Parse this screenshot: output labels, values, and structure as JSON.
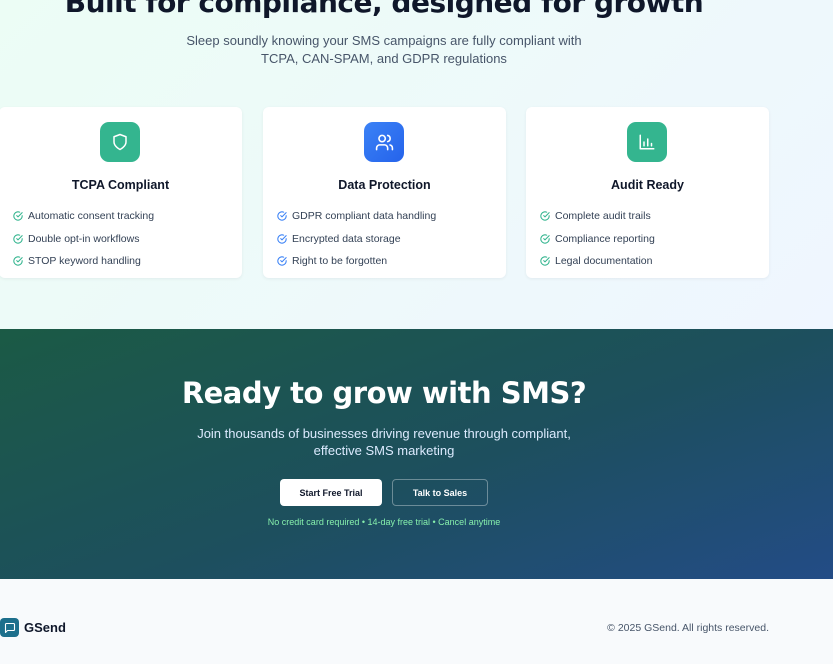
{
  "compliance": {
    "heading": "Built for compliance, designed for growth",
    "subheading": "Sleep soundly knowing your SMS campaigns are fully compliant with TCPA, CAN-SPAM, and GDPR regulations",
    "cards": [
      {
        "title": "TCPA Compliant",
        "icon": "shield-icon",
        "color": "#34b58f",
        "items": [
          "Automatic consent tracking",
          "Double opt-in workflows",
          "STOP keyword handling"
        ]
      },
      {
        "title": "Data Protection",
        "icon": "users-icon",
        "color": "#3b82f6",
        "items": [
          "GDPR compliant data handling",
          "Encrypted data storage",
          "Right to be forgotten"
        ]
      },
      {
        "title": "Audit Ready",
        "icon": "bar-chart-icon",
        "color": "#34b58f",
        "items": [
          "Complete audit trails",
          "Compliance reporting",
          "Legal documentation"
        ]
      }
    ]
  },
  "cta": {
    "heading": "Ready to grow with SMS?",
    "subheading": "Join thousands of businesses driving revenue through compliant, effective SMS marketing",
    "primary_button": "Start Free Trial",
    "secondary_button": "Talk to Sales",
    "note": "No credit card required • 14-day free trial • Cancel anytime"
  },
  "footer": {
    "brand": "GSend",
    "logo_icon": "message-square-icon",
    "copyright": "© 2025 GSend. All rights reserved."
  }
}
